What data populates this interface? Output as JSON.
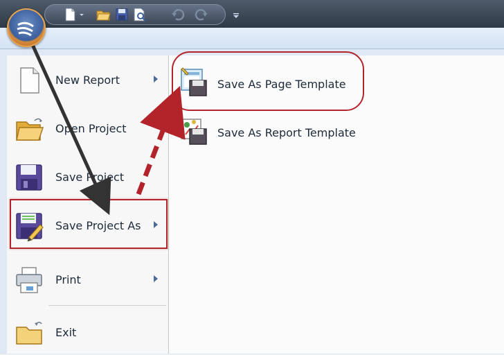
{
  "quick_access_toolbar": {
    "icons": [
      "new-document-icon",
      "dropdown-icon",
      "open-folder-icon",
      "save-icon",
      "print-preview-icon",
      "undo-icon",
      "redo-icon",
      "customize-toolbar-icon"
    ]
  },
  "app_menu": {
    "items": [
      {
        "label": "New Report",
        "icon": "new-document-icon",
        "has_submenu": true
      },
      {
        "label": "Open Project",
        "icon": "open-folder-icon",
        "has_submenu": false
      },
      {
        "label": "Save Project",
        "icon": "save-icon",
        "has_submenu": false
      },
      {
        "label": "Save Project As",
        "icon": "save-as-icon",
        "has_submenu": true
      },
      {
        "label": "Print",
        "icon": "printer-icon",
        "has_submenu": true
      },
      {
        "label": "Exit",
        "icon": "exit-folder-icon",
        "has_submenu": false
      }
    ]
  },
  "submenu": {
    "items": [
      {
        "label": "Save As Page Template",
        "icon": "page-template-icon"
      },
      {
        "label": "Save As Report Template",
        "icon": "report-template-icon"
      }
    ]
  },
  "annotation_colors": {
    "highlight": "#b3242a",
    "dark_arrow": "#333333"
  }
}
